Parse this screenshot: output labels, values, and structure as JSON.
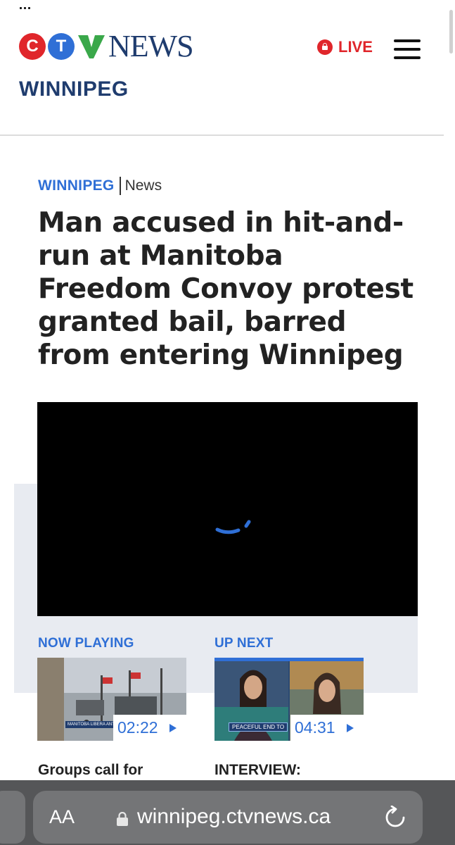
{
  "header": {
    "logo": {
      "letter_c": "C",
      "letter_t": "T",
      "letter_v": "V",
      "word": "NEWS"
    },
    "region_title": "WINNIPEG",
    "live_label": "LIVE"
  },
  "article": {
    "breadcrumb_region": "WINNIPEG",
    "breadcrumb_section": "News",
    "headline": "Man accused in hit-and-run at Manitoba Freedom Convoy protest granted bail, barred from entering Winnipeg"
  },
  "video": {
    "now_playing": {
      "label": "NOW PLAYING",
      "duration": "02:22",
      "lower_third": "MANITOBA LIBERA ANTI-MANDATE PR",
      "title": "Groups call for"
    },
    "up_next": {
      "label": "UP NEXT",
      "duration": "04:31",
      "lower_third": "PEACEFUL END TO",
      "title": "INTERVIEW:"
    }
  },
  "browser": {
    "text_size_button": "AA",
    "url": "winnipeg.ctvnews.ca"
  },
  "colors": {
    "brand_red": "#e0262b",
    "brand_blue": "#2f6fd6",
    "brand_navy": "#1f3c6e",
    "brand_green": "#3aa84a",
    "browser_bar": "#555658"
  },
  "icons": {
    "live": "lock-circle-icon",
    "menu": "hamburger-menu-icon",
    "spinner": "loading-spinner-icon",
    "play": "play-triangle-icon",
    "lock": "padlock-icon",
    "reload": "reload-icon"
  }
}
